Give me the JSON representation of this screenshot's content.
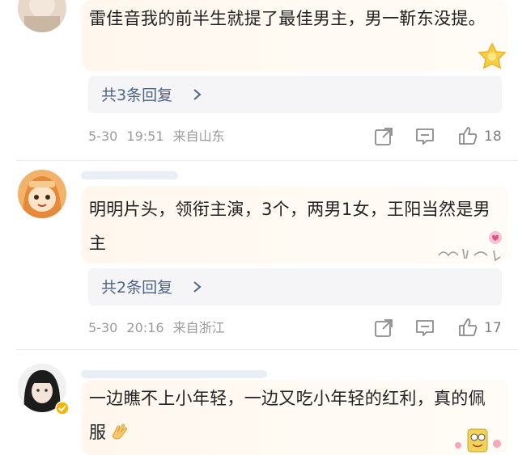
{
  "comments": [
    {
      "text": "雷佳音我的前半生就提了最佳男主，男一靳东没提。",
      "replies_label": "共3条回复",
      "date": "5-30",
      "time": "19:51",
      "location": "来自山东",
      "likes": "18"
    },
    {
      "text": "明明片头，领衔主演，3个，两男1女，王阳当然是男主",
      "replies_label": "共2条回复",
      "date": "5-30",
      "time": "20:16",
      "location": "来自浙江",
      "likes": "17"
    },
    {
      "text": "一边瞧不上小年轻，一边又吃小年轻的红利，真的佩服"
    }
  ],
  "colors": {
    "reply_link": "#4d6287",
    "meta_text": "#9a9a9a",
    "bubble": "#fff7ee"
  },
  "icons": [
    "share-icon",
    "comment-icon",
    "like-icon",
    "verified-badge-icon",
    "clap-emoji-icon"
  ]
}
